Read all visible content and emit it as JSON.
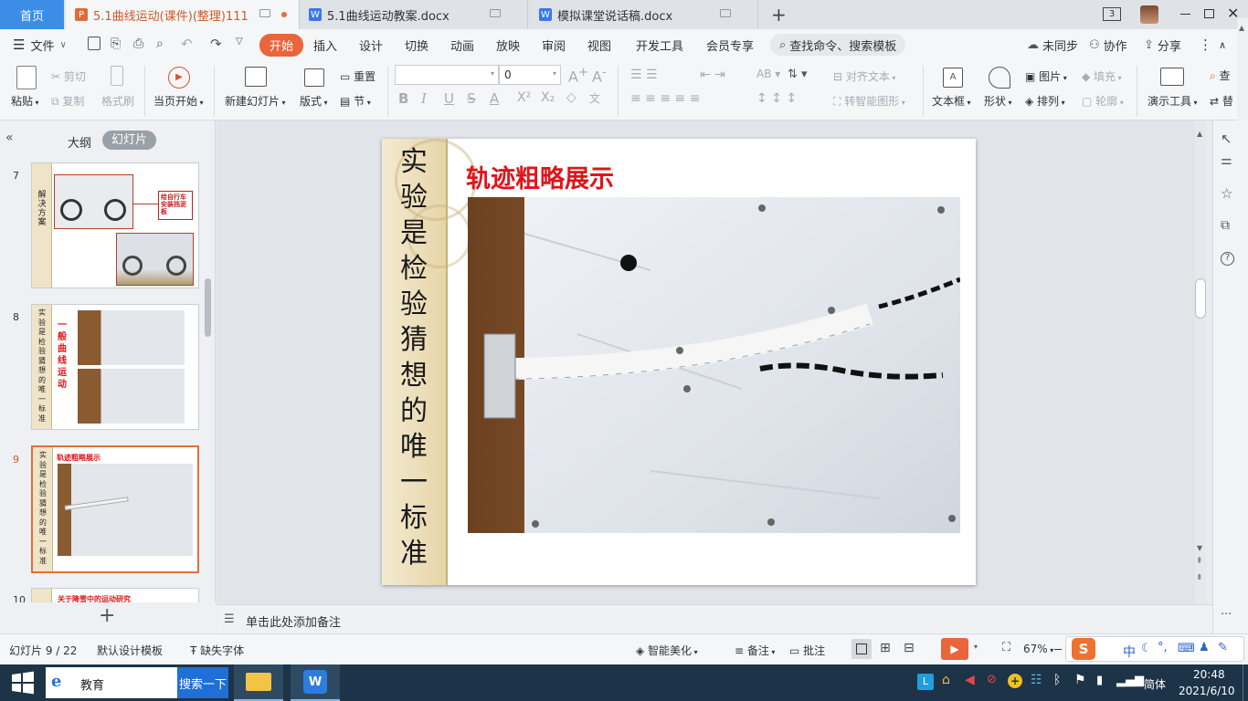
{
  "tabs": {
    "home": "首页",
    "docs": [
      {
        "label": "5.1曲线运动(课件)(整理)111",
        "type": "P",
        "active": true
      },
      {
        "label": "5.1曲线运动教案.docx",
        "type": "W",
        "active": false
      },
      {
        "label": "模拟课堂说话稿.docx",
        "type": "W",
        "active": false
      }
    ],
    "new_tab": "+",
    "window_count": "3"
  },
  "menu": {
    "file": "文件",
    "items": [
      "开始",
      "插入",
      "设计",
      "切换",
      "动画",
      "放映",
      "审阅",
      "视图",
      "开发工具",
      "会员专享"
    ],
    "search_placeholder": "查找命令、搜索模板",
    "sync": "未同步",
    "collab": "协作",
    "share": "分享"
  },
  "ribbon": {
    "paste": "粘贴",
    "cut": "剪切",
    "copy": "复制",
    "format_painter": "格式刷",
    "play_from_current": "当页开始",
    "new_slide": "新建幻灯片",
    "layout": "版式",
    "reset": "重置",
    "section": "节",
    "font_size": "0",
    "align_text": "对齐文本",
    "convert_smartart": "转智能图形",
    "textbox": "文本框",
    "shape": "形状",
    "picture": "图片",
    "fill": "填充",
    "arrange": "排列",
    "outline": "轮廓",
    "presentation_tools": "演示工具",
    "find": "查",
    "replace": "替"
  },
  "left_panel": {
    "view_outline": "大纲",
    "view_slides": "幻灯片",
    "add_slide": "+",
    "thumbnails": [
      {
        "num": "7",
        "band": "解决方案",
        "note": "给自行车安装挡泥板"
      },
      {
        "num": "8",
        "band": "实验是检验猜想的唯一标准",
        "side": "一般曲线运动"
      },
      {
        "num": "9",
        "band": "实验是检验猜想的唯一标准",
        "title": "轨迹粗略展示"
      },
      {
        "num": "10",
        "title": "关于降雪中的运动研究"
      }
    ]
  },
  "slide": {
    "vertical_title": "实验是检验猜想的唯一标准",
    "title": "轨迹粗略展示"
  },
  "notes": {
    "placeholder": "单击此处添加备注"
  },
  "status": {
    "slide_counter": "幻灯片 9 / 22",
    "template": "默认设计模板",
    "missing_font": "缺失字体",
    "beautify": "智能美化",
    "notes": "备注",
    "comments": "批注",
    "zoom": "67%",
    "ime": "中"
  },
  "taskbar": {
    "search_text": "教育",
    "search_button": "搜索一下",
    "time": "20:48",
    "date": "2021/6/10",
    "lang": "简体"
  },
  "colors": {
    "accent": "#e9653c",
    "home_tab": "#3d8de6",
    "slide_title": "#e0141a",
    "taskbar": "#1d3347"
  }
}
